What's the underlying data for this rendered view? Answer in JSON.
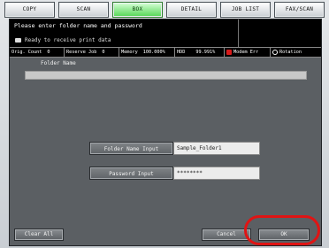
{
  "tabs": [
    {
      "label": "COPY"
    },
    {
      "label": "SCAN"
    },
    {
      "label": "BOX"
    },
    {
      "label": "DETAIL"
    },
    {
      "label": "JOB LIST"
    },
    {
      "label": "FAX/SCAN"
    }
  ],
  "message": {
    "line1": "Please enter folder name and password",
    "line2": "Ready to receive print data"
  },
  "status": {
    "orig_count_label": "Orig. Count",
    "orig_count_value": "0",
    "reserve_job_label": "Reserve Job",
    "reserve_job_value": "0",
    "memory_label": "Memory",
    "memory_value": "100.000%",
    "hdd_label": "HDD",
    "hdd_value": "99.991%",
    "modem_label": "Modem Err",
    "rotation_label": "Rotation"
  },
  "form": {
    "folder_name_heading": "Folder Name",
    "folder_name_button": "Folder Name Input",
    "folder_name_value": "Sample_Folder1",
    "password_button": "Password Input",
    "password_value": "********"
  },
  "footer": {
    "clear_all": "Clear All",
    "cancel": "Cancel",
    "ok": "OK"
  },
  "colors": {
    "active_tab": "#53d653",
    "highlight": "#e01414"
  },
  "icons": {
    "printer": "printer-icon",
    "modem_error": "warning-icon",
    "rotation": "rotation-icon"
  }
}
